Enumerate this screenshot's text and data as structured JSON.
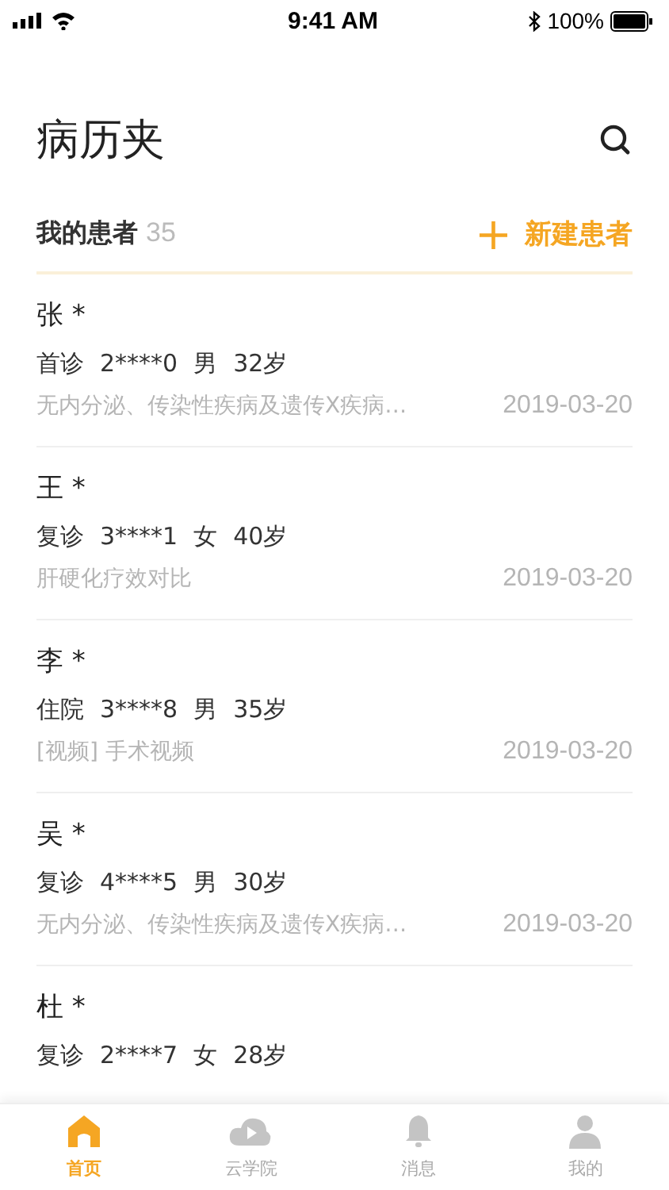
{
  "status_bar": {
    "time": "9:41 AM",
    "battery": "100%"
  },
  "title": "病历夹",
  "section": {
    "label": "我的患者",
    "count": "35",
    "add_icon": "+",
    "add_label": "新建患者"
  },
  "patients": [
    {
      "name": "张 *",
      "visit": "首诊",
      "id": "2****0",
      "sex": "男",
      "age": "32岁",
      "note": "无内分泌、传染性疾病及遗传X疾病…",
      "date": "2019-03-20"
    },
    {
      "name": "王 *",
      "visit": "复诊",
      "id": "3****1",
      "sex": "女",
      "age": "40岁",
      "note": "肝硬化疗效对比",
      "date": "2019-03-20"
    },
    {
      "name": "李 *",
      "visit": "住院",
      "id": "3****8",
      "sex": "男",
      "age": "35岁",
      "note": "[视频] 手术视频",
      "date": "2019-03-20"
    },
    {
      "name": "吴 *",
      "visit": "复诊",
      "id": "4****5",
      "sex": "男",
      "age": "30岁",
      "note": "无内分泌、传染性疾病及遗传X疾病…",
      "date": "2019-03-20"
    },
    {
      "name": "杜 *",
      "visit": "复诊",
      "id": "2****7",
      "sex": "女",
      "age": "28岁"
    }
  ],
  "tabs": [
    {
      "kind": "home",
      "label": "首页",
      "selected": true
    },
    {
      "kind": "cloud",
      "label": "云学院",
      "selected": false
    },
    {
      "kind": "bell",
      "label": "消息",
      "selected": false
    },
    {
      "kind": "person",
      "label": "我的",
      "selected": false
    }
  ]
}
